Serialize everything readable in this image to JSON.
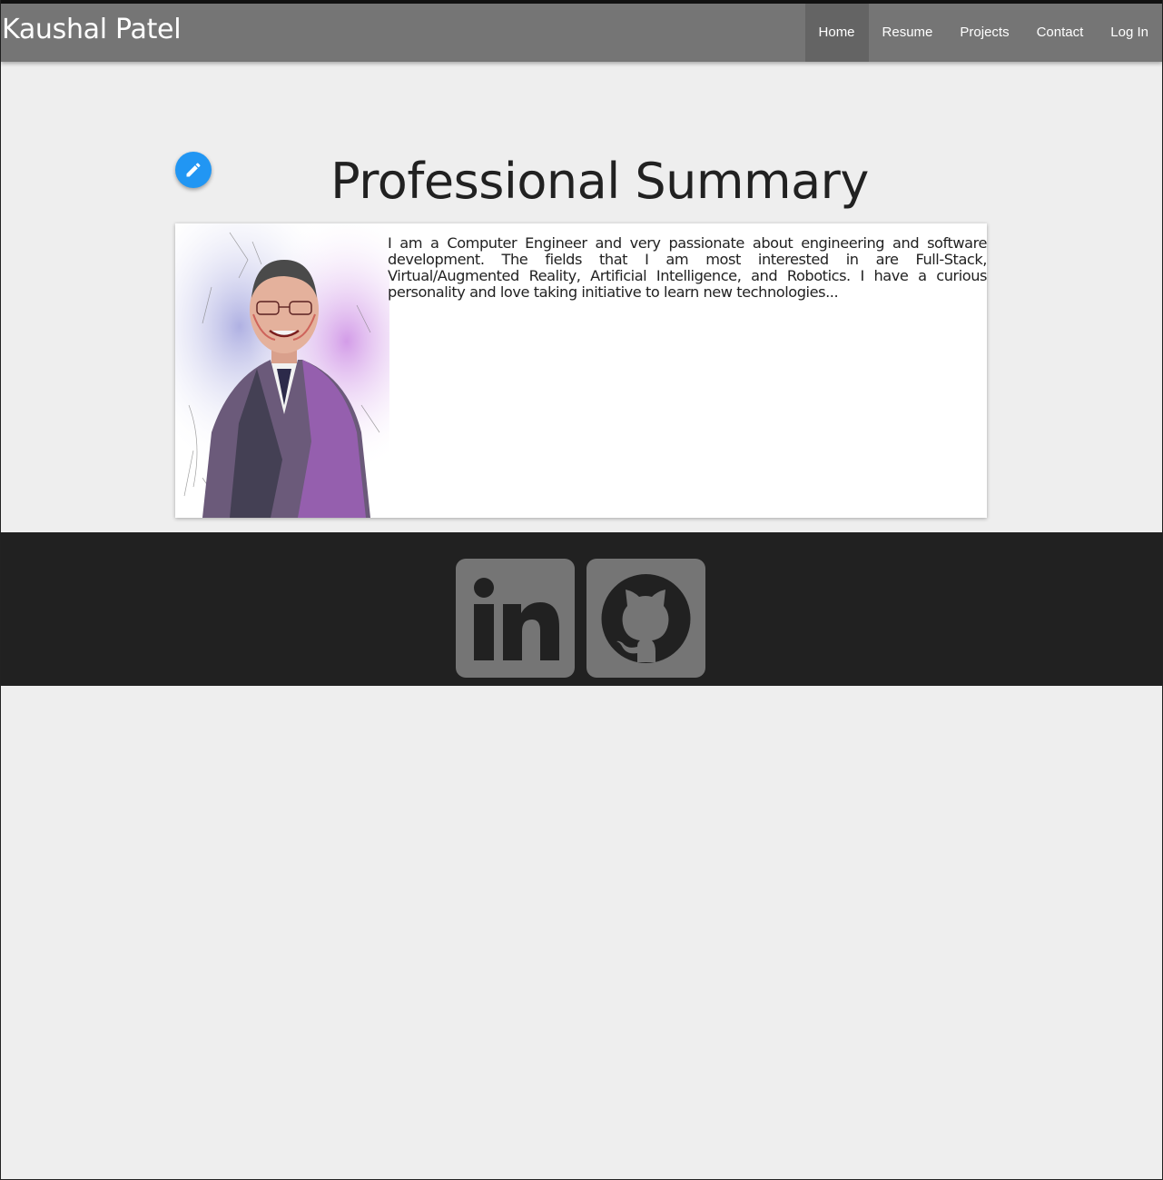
{
  "header": {
    "brand": "Kaushal Patel",
    "nav": [
      {
        "label": "Home",
        "active": true
      },
      {
        "label": "Resume",
        "active": false
      },
      {
        "label": "Projects",
        "active": false
      },
      {
        "label": "Contact",
        "active": false
      },
      {
        "label": "Log In",
        "active": false
      }
    ]
  },
  "main": {
    "title": "Professional Summary",
    "edit_icon": "pencil-icon",
    "summary": "I am a Computer Engineer and very passionate about engineering and software development. The fields that I am most interested in are Full-Stack, Virtual/Augmented Reality, Artificial Intelligence, and Robotics. I have a curious personality and love taking initiative to learn new technologies..."
  },
  "footer": {
    "links": [
      {
        "icon": "linkedin-icon",
        "label": "LinkedIn"
      },
      {
        "icon": "github-icon",
        "label": "GitHub"
      }
    ]
  },
  "colors": {
    "nav_bg": "#757575",
    "nav_active": "#646464",
    "accent": "#2196f3",
    "footer_bg": "#212121",
    "page_bg": "#eeeeee"
  }
}
